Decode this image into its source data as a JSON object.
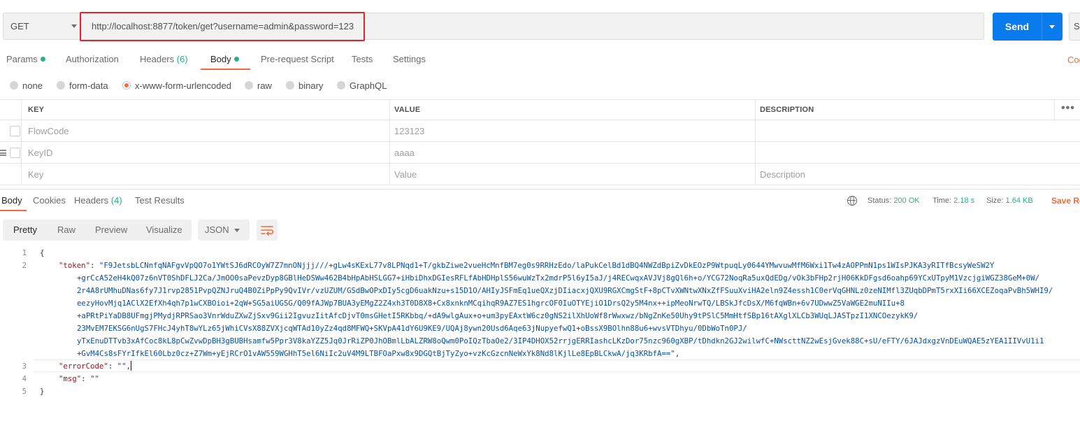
{
  "request": {
    "method": "GET",
    "url": "http://localhost:8877/token/get?username=admin&password=123",
    "send_label": "Send",
    "save_label": "S"
  },
  "request_tabs": {
    "params": "Params",
    "authorization": "Authorization",
    "headers": "Headers",
    "headers_count": "(6)",
    "body": "Body",
    "prerequest": "Pre-request Script",
    "tests": "Tests",
    "settings": "Settings",
    "code_link": "Coo"
  },
  "body_types": {
    "none": "none",
    "form_data": "form-data",
    "urlencoded": "x-www-form-urlencoded",
    "raw": "raw",
    "binary": "binary",
    "graphql": "GraphQL",
    "selected": "x-www-form-urlencoded"
  },
  "params_table": {
    "headers": {
      "key": "KEY",
      "value": "VALUE",
      "description": "DESCRIPTION"
    },
    "rows": [
      {
        "key": "FlowCode",
        "value": "123123",
        "description": ""
      },
      {
        "key": "KeyID",
        "value": "aaaa",
        "description": ""
      }
    ],
    "placeholder": {
      "key": "Key",
      "value": "Value",
      "description": "Description"
    }
  },
  "response_tabs": {
    "body": "Body",
    "cookies": "Cookies",
    "headers": "Headers",
    "headers_count": "(4)",
    "test_results": "Test Results"
  },
  "response_meta": {
    "status_label": "Status:",
    "status_value": "200 OK",
    "time_label": "Time:",
    "time_value": "2.18 s",
    "size_label": "Size:",
    "size_value": "1.64 KB",
    "save_response": "Save Re"
  },
  "view_modes": {
    "pretty": "Pretty",
    "raw": "Raw",
    "preview": "Preview",
    "visualize": "Visualize",
    "format": "JSON"
  },
  "response_json": {
    "line_numbers": [
      "1",
      "2",
      "3",
      "4",
      "5"
    ],
    "open_brace": "{",
    "close_brace": "}",
    "token_key": "\"token\"",
    "token_lines": [
      "\"F9JetsbLCNnfqNAFgvVpQO7o1YWtSJ6dRCOyW7Z7mnONjjj///+gLw4sKExL77v8LPNqd1+T/gkbZiwe2vueHcMnfBM7eg0s9RRHzEdo/laPukCelBd1dBQ4NWZdBpiZvDkEOzP9WtpuqLy0644YMwvuwMfM6Wxi1Tw4zAOPPmN1ps1WIsPJKA3yRITfBcsyWeSW2Y",
      "+grCcA52eH4kQ07z6nVT0ShDFLJ2Ca/JmOO0saPevzDyp8GBlHeDSWw462B4bHpAbHSLGG7+iHbiDhxDGIesRFLfAbHDHplS56wuWzTx2mdrP5l6yI5aJ/j4RECwqxAVJVj8gQl6h+o/YCG72NoqRa5uxQdEDg/vOk3bFHp2rjH06KkDFgsd6oahp69YCxUTpyM1VzcjgiWGZ38GeM+0W/",
      "2r4A8rUMhuDNas6fy7J1rvp2851PvpQZNJruQ4B0ZiPpPy9QvIVr/vzUZUM/GSdBwOPxDIy5cgD6uakNzu+s15D1O/AHIyJSFmEq1ueQXzjDIiacxjQXU9RGXCmgStF+8pCTvXWNtwXNxZfFSuuXviHA2eln9Z4essh1C0erVqGHNLz0zeNIMfl3ZUqbDPmT5rxXIi66XCEZoqaPvBh5WHI9/",
      "eezyHovMjq1AClX2EfXh4qh7p1wCXBOioi+2qW+SG5aiUGSG/Q09fAJWp7BUA3yEMgZ2Z4xh3T0D8X8+Cx8xnknMCqihqR9AZ7ES1hgrcOF0IuOTYEjiO1DrsQ2y5M4nx++ipMeoNrwTQ/LBSkJfcDsX/M6fqWBn+6v7UDwwZ5VaWGE2muNIIu+8",
      "+aPRtPiYaDB8UFmgjPMydjRPRSao3VnrWduZXwZjSxv9Gii2IgvuzIitAfcDjvT0msGHetI5RKbbq/+dA9wlgAux+o+um3pyEAxtW6cz0gNS2ilXhUoWf8rWwxwz/bNgZnKe50Uhy9tPSlC5MmHtfSBp16tAXglXLCb3WUqLJASTpzI1XNCOezykK9/",
      "23MvEM7EKSG6nUgS7FHcJ4yhT8wYLz65jWhiCVsX88ZVXjcqWTAd10yZz4qd8MFWQ+SKVpA41dY6U9KE9/UQAj8ywn20Usd6Aqe63jNupyefwQ1+oBssX9BOlhn88u6+wvsVTDhyu/0DbWoTn0PJ/",
      "yTxEnuDTTvb3xAfCoc8kL8pCwZvwDpBH3gBUBHsamfw5Ppr3V8kaYZZ5Jq0JrRiZP0JhOBmlLbALZRW8oQwm0PoIQzTbaOe2/3IP4DHOX52rrjgERRIashcLKzDor75nzc960gXBP/tDhdkn2GJ2wilwfC+NWscttNZ2wEsjGvek88C+sU/eFTY/6JAJdxgzVnDEuWQAE5zYEA1IIVvU1i1",
      "+GvM4Cs8sFYrIfkEl60Lbz0cz+Z7Wm+yEjRCrO1vAW559WGHhT5el6NiIc2uV4M9LTBFOaPxw8x9DGQtBjTyZyo+vzKcGzcnNeWxYk8Nd8lKjlLe8EpBLCkwA/jq3KRbfA==\""
    ],
    "error_key": "\"errorCode\"",
    "error_value": "\"\"",
    "msg_key": "\"msg\"",
    "msg_value": "\"\""
  },
  "colors": {
    "accent": "#f26b3a",
    "send": "#097bed",
    "success": "#26b47f",
    "annotation_box": "#e0252b"
  }
}
